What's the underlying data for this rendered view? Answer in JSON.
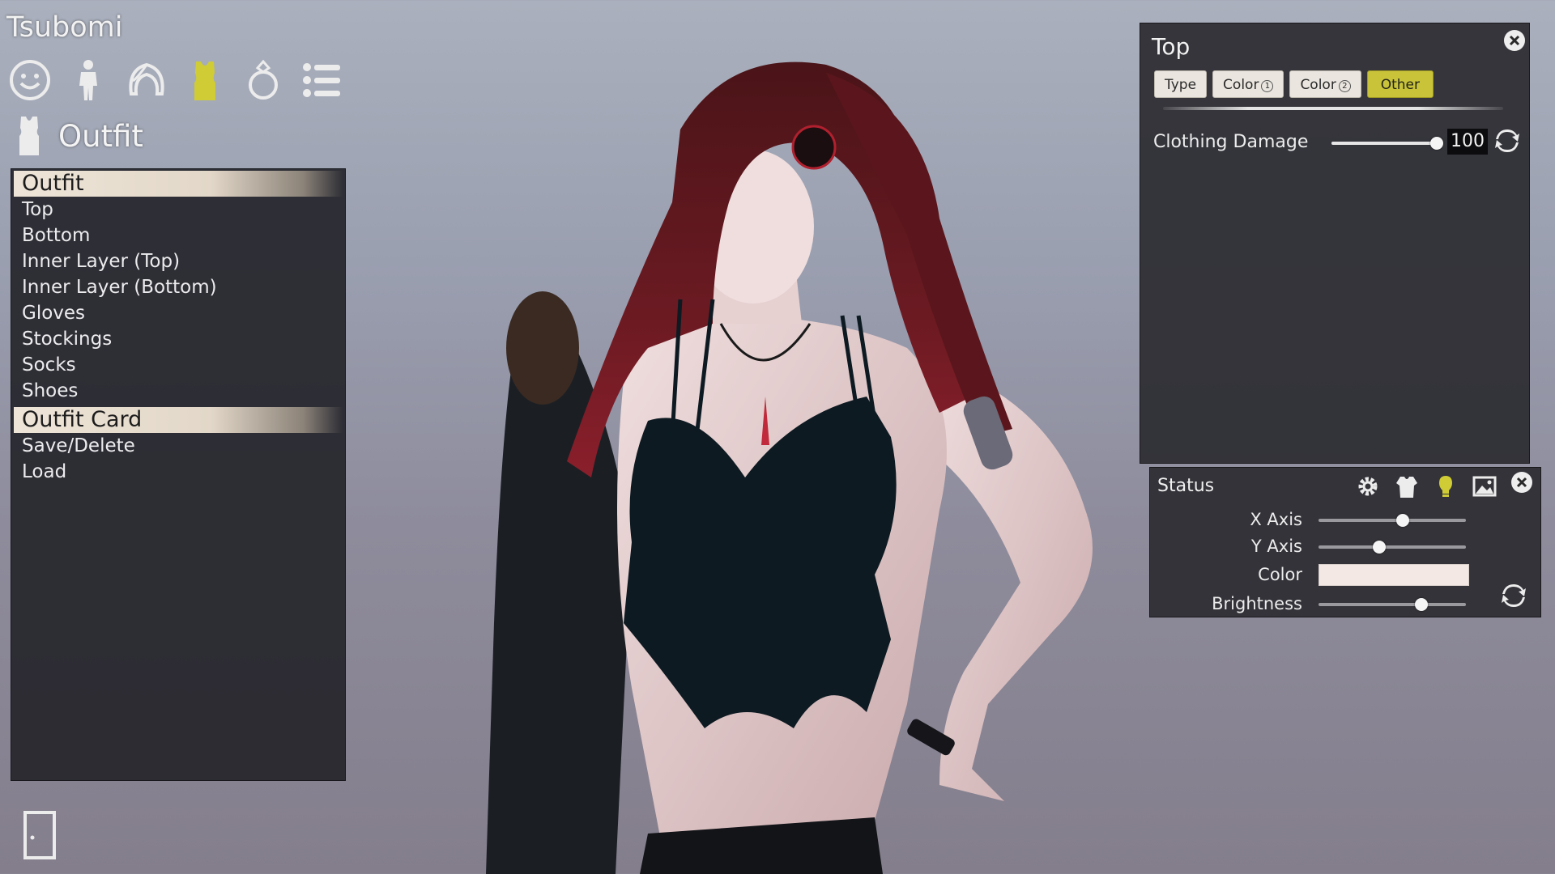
{
  "character": {
    "name": "Tsubomi"
  },
  "category_bar": {
    "items": [
      {
        "name": "face-icon",
        "color": "#e8e8e8",
        "active": false
      },
      {
        "name": "body-icon",
        "color": "#e8e8e8",
        "active": false
      },
      {
        "name": "hair-icon",
        "color": "#e8e8e8",
        "active": false
      },
      {
        "name": "outfit-icon",
        "color": "#cfcc35",
        "active": true
      },
      {
        "name": "accessory-icon",
        "color": "#e8e8e8",
        "active": false
      },
      {
        "name": "list-icon",
        "color": "#e8e8e8",
        "active": false
      }
    ]
  },
  "section": {
    "title": "Outfit",
    "icon": "shirt-icon"
  },
  "left_panel": {
    "groups": [
      {
        "label": "Outfit",
        "items": [
          "Top",
          "Bottom",
          "Inner Layer (Top)",
          "Inner Layer (Bottom)",
          "Gloves",
          "Stockings",
          "Socks",
          "Shoes"
        ]
      },
      {
        "label": "Outfit Card",
        "items": [
          "Save/Delete",
          "Load"
        ]
      }
    ]
  },
  "exit": {
    "icon": "door-icon"
  },
  "top_panel": {
    "title": "Top",
    "tabs": [
      {
        "label": "Type",
        "suffix": "",
        "active": false
      },
      {
        "label": "Color",
        "suffix": "1",
        "active": false
      },
      {
        "label": "Color",
        "suffix": "2",
        "active": false
      },
      {
        "label": "Other",
        "suffix": "",
        "active": true
      }
    ],
    "clothing_damage": {
      "label": "Clothing Damage",
      "value": "100",
      "fraction": 1.0
    }
  },
  "status_panel": {
    "title": "Status",
    "icons": [
      "gear-icon",
      "clothing-icon",
      "light-bulb-icon",
      "image-icon"
    ],
    "rows": [
      {
        "label": "X Axis",
        "kind": "slider",
        "fraction": 0.57
      },
      {
        "label": "Y Axis",
        "kind": "slider",
        "fraction": 0.41
      },
      {
        "label": "Color",
        "kind": "color",
        "color": "#f3e8e4"
      },
      {
        "label": "Brightness",
        "kind": "slider",
        "fraction": 0.7
      }
    ]
  },
  "colors": {
    "accent": "#cfcc35",
    "panel_bg": "#2c2c32",
    "header_gradient": "#eee5d8"
  }
}
